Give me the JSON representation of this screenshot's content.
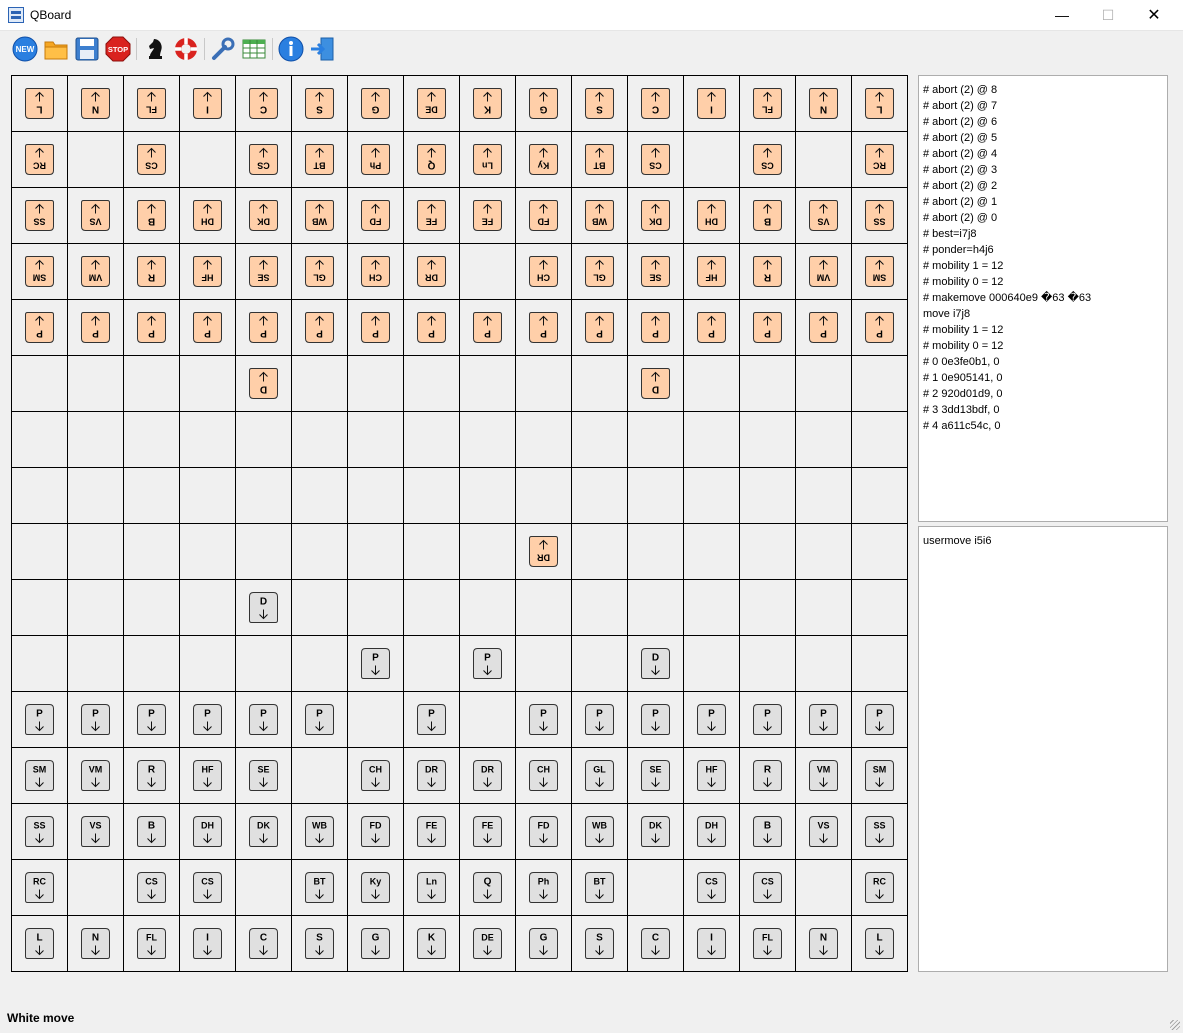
{
  "window": {
    "title": "QBoard"
  },
  "toolbar": {
    "items": [
      {
        "icon": "new-game-icon",
        "label": "NEW"
      },
      {
        "icon": "open-folder-icon"
      },
      {
        "icon": "save-disk-icon"
      },
      {
        "icon": "stop-icon",
        "label": "STOP"
      },
      {
        "icon": "knight-engine-icon"
      },
      {
        "icon": "lifebuoy-icon"
      },
      {
        "icon": "wrench-settings-icon"
      },
      {
        "icon": "table-grid-icon"
      },
      {
        "icon": "info-icon"
      },
      {
        "icon": "exit-door-icon"
      }
    ]
  },
  "board": {
    "files": 16,
    "ranks": 16,
    "colors": {
      "square": "#f0f0f0",
      "line": "#000000",
      "black_piece": "#ffcfa9",
      "white_piece": "#e0e0e0",
      "ink": "#000000"
    },
    "black_pieces": [
      {
        "r": 0,
        "c": 0,
        "l": "L"
      },
      {
        "r": 0,
        "c": 1,
        "l": "N"
      },
      {
        "r": 0,
        "c": 2,
        "l": "FL"
      },
      {
        "r": 0,
        "c": 3,
        "l": "I"
      },
      {
        "r": 0,
        "c": 4,
        "l": "C"
      },
      {
        "r": 0,
        "c": 5,
        "l": "S"
      },
      {
        "r": 0,
        "c": 6,
        "l": "G"
      },
      {
        "r": 0,
        "c": 7,
        "l": "DE"
      },
      {
        "r": 0,
        "c": 8,
        "l": "K"
      },
      {
        "r": 0,
        "c": 9,
        "l": "G"
      },
      {
        "r": 0,
        "c": 10,
        "l": "S"
      },
      {
        "r": 0,
        "c": 11,
        "l": "C"
      },
      {
        "r": 0,
        "c": 12,
        "l": "I"
      },
      {
        "r": 0,
        "c": 13,
        "l": "FL"
      },
      {
        "r": 0,
        "c": 14,
        "l": "N"
      },
      {
        "r": 0,
        "c": 15,
        "l": "L"
      },
      {
        "r": 1,
        "c": 0,
        "l": "RC"
      },
      {
        "r": 1,
        "c": 2,
        "l": "CS"
      },
      {
        "r": 1,
        "c": 4,
        "l": "CS"
      },
      {
        "r": 1,
        "c": 5,
        "l": "BT"
      },
      {
        "r": 1,
        "c": 6,
        "l": "Ph"
      },
      {
        "r": 1,
        "c": 7,
        "l": "Q"
      },
      {
        "r": 1,
        "c": 8,
        "l": "Ln"
      },
      {
        "r": 1,
        "c": 9,
        "l": "Ky"
      },
      {
        "r": 1,
        "c": 10,
        "l": "BT"
      },
      {
        "r": 1,
        "c": 11,
        "l": "CS"
      },
      {
        "r": 1,
        "c": 13,
        "l": "CS"
      },
      {
        "r": 1,
        "c": 15,
        "l": "RC"
      },
      {
        "r": 2,
        "c": 0,
        "l": "SS"
      },
      {
        "r": 2,
        "c": 1,
        "l": "VS"
      },
      {
        "r": 2,
        "c": 2,
        "l": "B"
      },
      {
        "r": 2,
        "c": 3,
        "l": "DH"
      },
      {
        "r": 2,
        "c": 4,
        "l": "DK"
      },
      {
        "r": 2,
        "c": 5,
        "l": "WB"
      },
      {
        "r": 2,
        "c": 6,
        "l": "FD"
      },
      {
        "r": 2,
        "c": 7,
        "l": "FE"
      },
      {
        "r": 2,
        "c": 8,
        "l": "FE"
      },
      {
        "r": 2,
        "c": 9,
        "l": "FD"
      },
      {
        "r": 2,
        "c": 10,
        "l": "WB"
      },
      {
        "r": 2,
        "c": 11,
        "l": "DK"
      },
      {
        "r": 2,
        "c": 12,
        "l": "DH"
      },
      {
        "r": 2,
        "c": 13,
        "l": "B"
      },
      {
        "r": 2,
        "c": 14,
        "l": "VS"
      },
      {
        "r": 2,
        "c": 15,
        "l": "SS"
      },
      {
        "r": 3,
        "c": 0,
        "l": "SM"
      },
      {
        "r": 3,
        "c": 1,
        "l": "VM"
      },
      {
        "r": 3,
        "c": 2,
        "l": "R"
      },
      {
        "r": 3,
        "c": 3,
        "l": "HF"
      },
      {
        "r": 3,
        "c": 4,
        "l": "SE"
      },
      {
        "r": 3,
        "c": 5,
        "l": "GL"
      },
      {
        "r": 3,
        "c": 6,
        "l": "CH"
      },
      {
        "r": 3,
        "c": 7,
        "l": "DR"
      },
      {
        "r": 3,
        "c": 9,
        "l": "CH"
      },
      {
        "r": 3,
        "c": 10,
        "l": "GL"
      },
      {
        "r": 3,
        "c": 11,
        "l": "SE"
      },
      {
        "r": 3,
        "c": 12,
        "l": "HF"
      },
      {
        "r": 3,
        "c": 13,
        "l": "R"
      },
      {
        "r": 3,
        "c": 14,
        "l": "VM"
      },
      {
        "r": 3,
        "c": 15,
        "l": "SM"
      },
      {
        "r": 4,
        "c": 0,
        "l": "P"
      },
      {
        "r": 4,
        "c": 1,
        "l": "P"
      },
      {
        "r": 4,
        "c": 2,
        "l": "P"
      },
      {
        "r": 4,
        "c": 3,
        "l": "P"
      },
      {
        "r": 4,
        "c": 4,
        "l": "P"
      },
      {
        "r": 4,
        "c": 5,
        "l": "P"
      },
      {
        "r": 4,
        "c": 6,
        "l": "P"
      },
      {
        "r": 4,
        "c": 7,
        "l": "P"
      },
      {
        "r": 4,
        "c": 8,
        "l": "P"
      },
      {
        "r": 4,
        "c": 9,
        "l": "P"
      },
      {
        "r": 4,
        "c": 10,
        "l": "P"
      },
      {
        "r": 4,
        "c": 11,
        "l": "P"
      },
      {
        "r": 4,
        "c": 12,
        "l": "P"
      },
      {
        "r": 4,
        "c": 13,
        "l": "P"
      },
      {
        "r": 4,
        "c": 14,
        "l": "P"
      },
      {
        "r": 4,
        "c": 15,
        "l": "P"
      },
      {
        "r": 5,
        "c": 4,
        "l": "D"
      },
      {
        "r": 5,
        "c": 11,
        "l": "D"
      },
      {
        "r": 8,
        "c": 9,
        "l": "DR"
      }
    ],
    "white_pieces": [
      {
        "r": 9,
        "c": 4,
        "l": "D"
      },
      {
        "r": 10,
        "c": 6,
        "l": "P"
      },
      {
        "r": 10,
        "c": 8,
        "l": "P"
      },
      {
        "r": 10,
        "c": 11,
        "l": "D"
      },
      {
        "r": 11,
        "c": 0,
        "l": "P"
      },
      {
        "r": 11,
        "c": 1,
        "l": "P"
      },
      {
        "r": 11,
        "c": 2,
        "l": "P"
      },
      {
        "r": 11,
        "c": 3,
        "l": "P"
      },
      {
        "r": 11,
        "c": 4,
        "l": "P"
      },
      {
        "r": 11,
        "c": 5,
        "l": "P"
      },
      {
        "r": 11,
        "c": 7,
        "l": "P"
      },
      {
        "r": 11,
        "c": 9,
        "l": "P"
      },
      {
        "r": 11,
        "c": 10,
        "l": "P"
      },
      {
        "r": 11,
        "c": 11,
        "l": "P"
      },
      {
        "r": 11,
        "c": 12,
        "l": "P"
      },
      {
        "r": 11,
        "c": 13,
        "l": "P"
      },
      {
        "r": 11,
        "c": 14,
        "l": "P"
      },
      {
        "r": 11,
        "c": 15,
        "l": "P"
      },
      {
        "r": 12,
        "c": 0,
        "l": "SM"
      },
      {
        "r": 12,
        "c": 1,
        "l": "VM"
      },
      {
        "r": 12,
        "c": 2,
        "l": "R"
      },
      {
        "r": 12,
        "c": 3,
        "l": "HF"
      },
      {
        "r": 12,
        "c": 4,
        "l": "SE"
      },
      {
        "r": 12,
        "c": 6,
        "l": "CH"
      },
      {
        "r": 12,
        "c": 7,
        "l": "DR"
      },
      {
        "r": 12,
        "c": 8,
        "l": "DR"
      },
      {
        "r": 12,
        "c": 9,
        "l": "CH"
      },
      {
        "r": 12,
        "c": 10,
        "l": "GL"
      },
      {
        "r": 12,
        "c": 11,
        "l": "SE"
      },
      {
        "r": 12,
        "c": 12,
        "l": "HF"
      },
      {
        "r": 12,
        "c": 13,
        "l": "R"
      },
      {
        "r": 12,
        "c": 14,
        "l": "VM"
      },
      {
        "r": 12,
        "c": 15,
        "l": "SM"
      },
      {
        "r": 13,
        "c": 0,
        "l": "SS"
      },
      {
        "r": 13,
        "c": 1,
        "l": "VS"
      },
      {
        "r": 13,
        "c": 2,
        "l": "B"
      },
      {
        "r": 13,
        "c": 3,
        "l": "DH"
      },
      {
        "r": 13,
        "c": 4,
        "l": "DK"
      },
      {
        "r": 13,
        "c": 5,
        "l": "WB"
      },
      {
        "r": 13,
        "c": 6,
        "l": "FD"
      },
      {
        "r": 13,
        "c": 7,
        "l": "FE"
      },
      {
        "r": 13,
        "c": 8,
        "l": "FE"
      },
      {
        "r": 13,
        "c": 9,
        "l": "FD"
      },
      {
        "r": 13,
        "c": 10,
        "l": "WB"
      },
      {
        "r": 13,
        "c": 11,
        "l": "DK"
      },
      {
        "r": 13,
        "c": 12,
        "l": "DH"
      },
      {
        "r": 13,
        "c": 13,
        "l": "B"
      },
      {
        "r": 13,
        "c": 14,
        "l": "VS"
      },
      {
        "r": 13,
        "c": 15,
        "l": "SS"
      },
      {
        "r": 14,
        "c": 0,
        "l": "RC"
      },
      {
        "r": 14,
        "c": 2,
        "l": "CS"
      },
      {
        "r": 14,
        "c": 3,
        "l": "CS"
      },
      {
        "r": 14,
        "c": 5,
        "l": "BT"
      },
      {
        "r": 14,
        "c": 6,
        "l": "Ky"
      },
      {
        "r": 14,
        "c": 7,
        "l": "Ln"
      },
      {
        "r": 14,
        "c": 8,
        "l": "Q"
      },
      {
        "r": 14,
        "c": 9,
        "l": "Ph"
      },
      {
        "r": 14,
        "c": 10,
        "l": "BT"
      },
      {
        "r": 14,
        "c": 12,
        "l": "CS"
      },
      {
        "r": 14,
        "c": 13,
        "l": "CS"
      },
      {
        "r": 14,
        "c": 15,
        "l": "RC"
      },
      {
        "r": 15,
        "c": 0,
        "l": "L"
      },
      {
        "r": 15,
        "c": 1,
        "l": "N"
      },
      {
        "r": 15,
        "c": 2,
        "l": "FL"
      },
      {
        "r": 15,
        "c": 3,
        "l": "I"
      },
      {
        "r": 15,
        "c": 4,
        "l": "C"
      },
      {
        "r": 15,
        "c": 5,
        "l": "S"
      },
      {
        "r": 15,
        "c": 6,
        "l": "G"
      },
      {
        "r": 15,
        "c": 7,
        "l": "K"
      },
      {
        "r": 15,
        "c": 8,
        "l": "DE"
      },
      {
        "r": 15,
        "c": 9,
        "l": "G"
      },
      {
        "r": 15,
        "c": 10,
        "l": "S"
      },
      {
        "r": 15,
        "c": 11,
        "l": "C"
      },
      {
        "r": 15,
        "c": 12,
        "l": "I"
      },
      {
        "r": 15,
        "c": 13,
        "l": "FL"
      },
      {
        "r": 15,
        "c": 14,
        "l": "N"
      },
      {
        "r": 15,
        "c": 15,
        "l": "L"
      }
    ]
  },
  "engine_output": "# abort (2) @ 8\n# abort (2) @ 7\n# abort (2) @ 6\n# abort (2) @ 5\n# abort (2) @ 4\n# abort (2) @ 3\n# abort (2) @ 2\n# abort (2) @ 1\n# abort (2) @ 0\n# best=i7j8\n# ponder=h4j6\n# mobility 1 = 12\n# mobility 0 = 12\n# makemove 000640e9 �63 �63\nmove i7j8\n# mobility 1 = 12\n# mobility 0 = 12\n# 0 0e3fe0b1, 0\n# 1 0e905141, 0\n# 2 920d01d9, 0\n# 3 3dd13bdf, 0\n# 4 a611c54c, 0",
  "engine_input": "usermove i5i6",
  "status": "White move"
}
